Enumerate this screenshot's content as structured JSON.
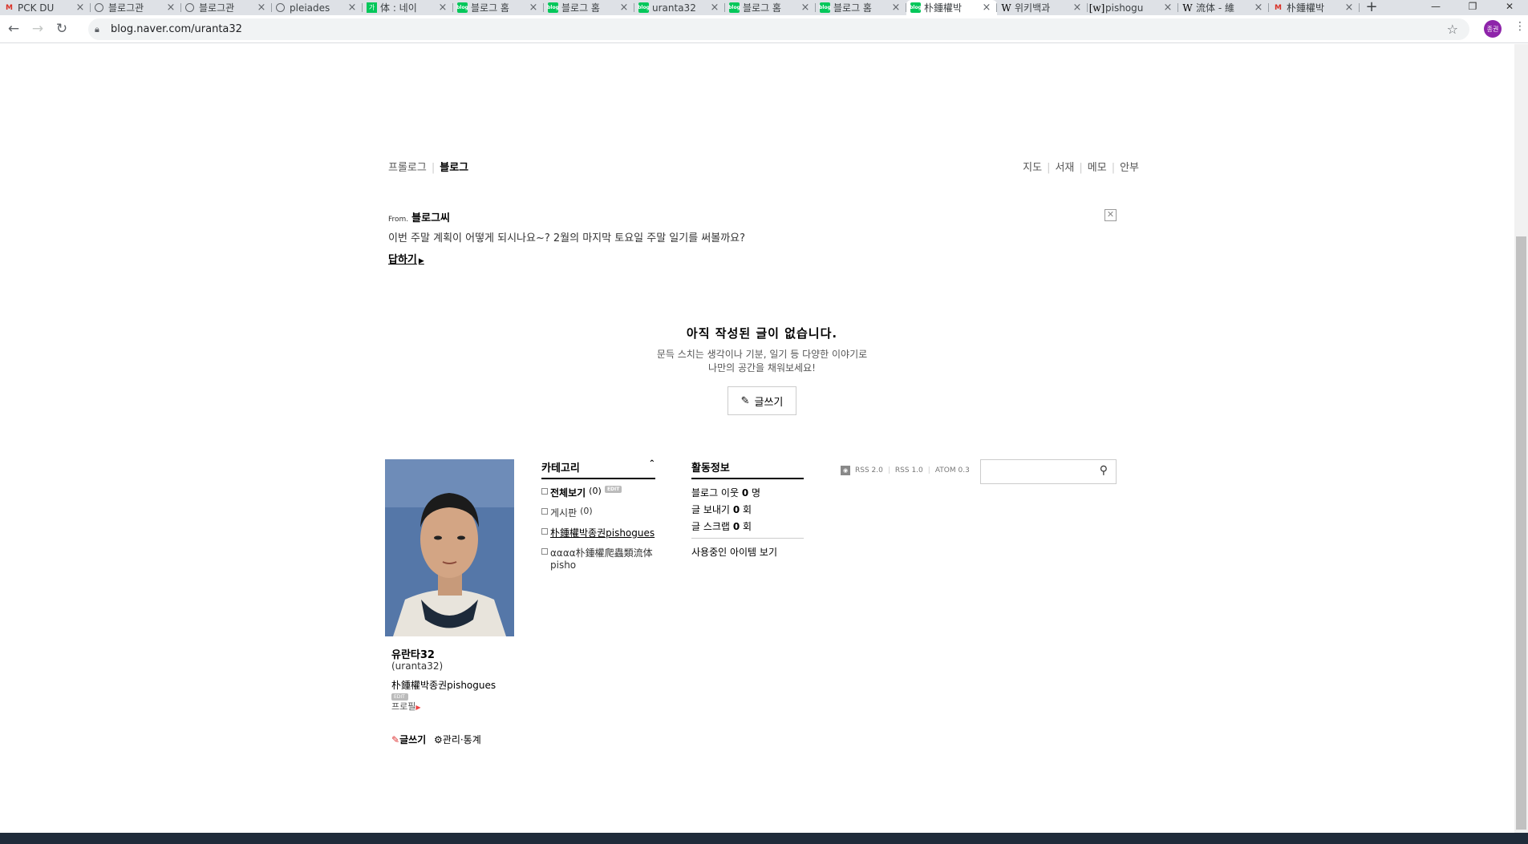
{
  "browser": {
    "tabs": [
      {
        "title": "PCK DU",
        "icon": "gmail"
      },
      {
        "title": "블로그관",
        "icon": "globe"
      },
      {
        "title": "블로그관",
        "icon": "globe"
      },
      {
        "title": "pleiades",
        "icon": "globe"
      },
      {
        "title": "体 : 네이",
        "icon": "kor"
      },
      {
        "title": "블로그 홈",
        "icon": "naver"
      },
      {
        "title": "블로그 홈",
        "icon": "naver"
      },
      {
        "title": "uranta32",
        "icon": "naver"
      },
      {
        "title": "블로그 홈",
        "icon": "naver"
      },
      {
        "title": "블로그 홈",
        "icon": "naver"
      },
      {
        "title": "朴鍾權박",
        "icon": "naver",
        "active": true
      },
      {
        "title": "위키백과",
        "icon": "wiki"
      },
      {
        "title": "pishogu",
        "icon": "wikiw"
      },
      {
        "title": "流体 - 維",
        "icon": "wiki"
      },
      {
        "title": "朴鍾權박",
        "icon": "gmail"
      }
    ],
    "url": "blog.naver.com/uranta32",
    "profile_initials": "종권"
  },
  "blog": {
    "nav_left": {
      "prologue": "프롤로그",
      "blog": "블로그"
    },
    "nav_right": [
      "지도",
      "서재",
      "메모",
      "안부"
    ],
    "notice": {
      "from_prefix": "From.",
      "from_name": "블로그씨",
      "message": "이번 주말 계획이 어떻게 되시나요~? 2월의 마지막 토요일 주말 일기를 써볼까요?",
      "reply": "답하기"
    },
    "empty": {
      "title": "아직 작성된 글이 없습니다.",
      "desc_line1": "문득 스치는 생각이나 기분, 일기 등 다양한 이야기로",
      "desc_line2": "나만의 공간을 채워보세요!",
      "write_button": "글쓰기"
    },
    "profile": {
      "nickname": "유란타32",
      "id": "(uranta32)",
      "intro": "朴鍾權박종권pishogues",
      "edit": "EDIT",
      "profile_link": "프로필",
      "write": "글쓰기",
      "manage": "관리·통계"
    },
    "category": {
      "title": "카테고리",
      "all": "전체보기",
      "all_count": "(0)",
      "edit": "EDIT",
      "items": [
        {
          "label": "게시판",
          "count": "(0)"
        },
        {
          "label": "朴鍾權박종권pishogues",
          "count": ""
        },
        {
          "label": "αααα朴鍾權爬蟲類流体pisho",
          "count": ""
        }
      ]
    },
    "activity": {
      "title": "활동정보",
      "neighbors_label": "블로그 이웃",
      "neighbors_value": "0",
      "neighbors_unit": "명",
      "send_label": "글 보내기",
      "send_value": "0",
      "send_unit": "회",
      "scrap_label": "글 스크랩",
      "scrap_value": "0",
      "scrap_unit": "회",
      "items_link": "사용중인 아이템 보기"
    },
    "rss": [
      "RSS 2.0",
      "RSS 1.0",
      "ATOM 0.3"
    ]
  },
  "colors": {
    "naver_green": "#03c75a",
    "profile_purple": "#8e24aa"
  }
}
